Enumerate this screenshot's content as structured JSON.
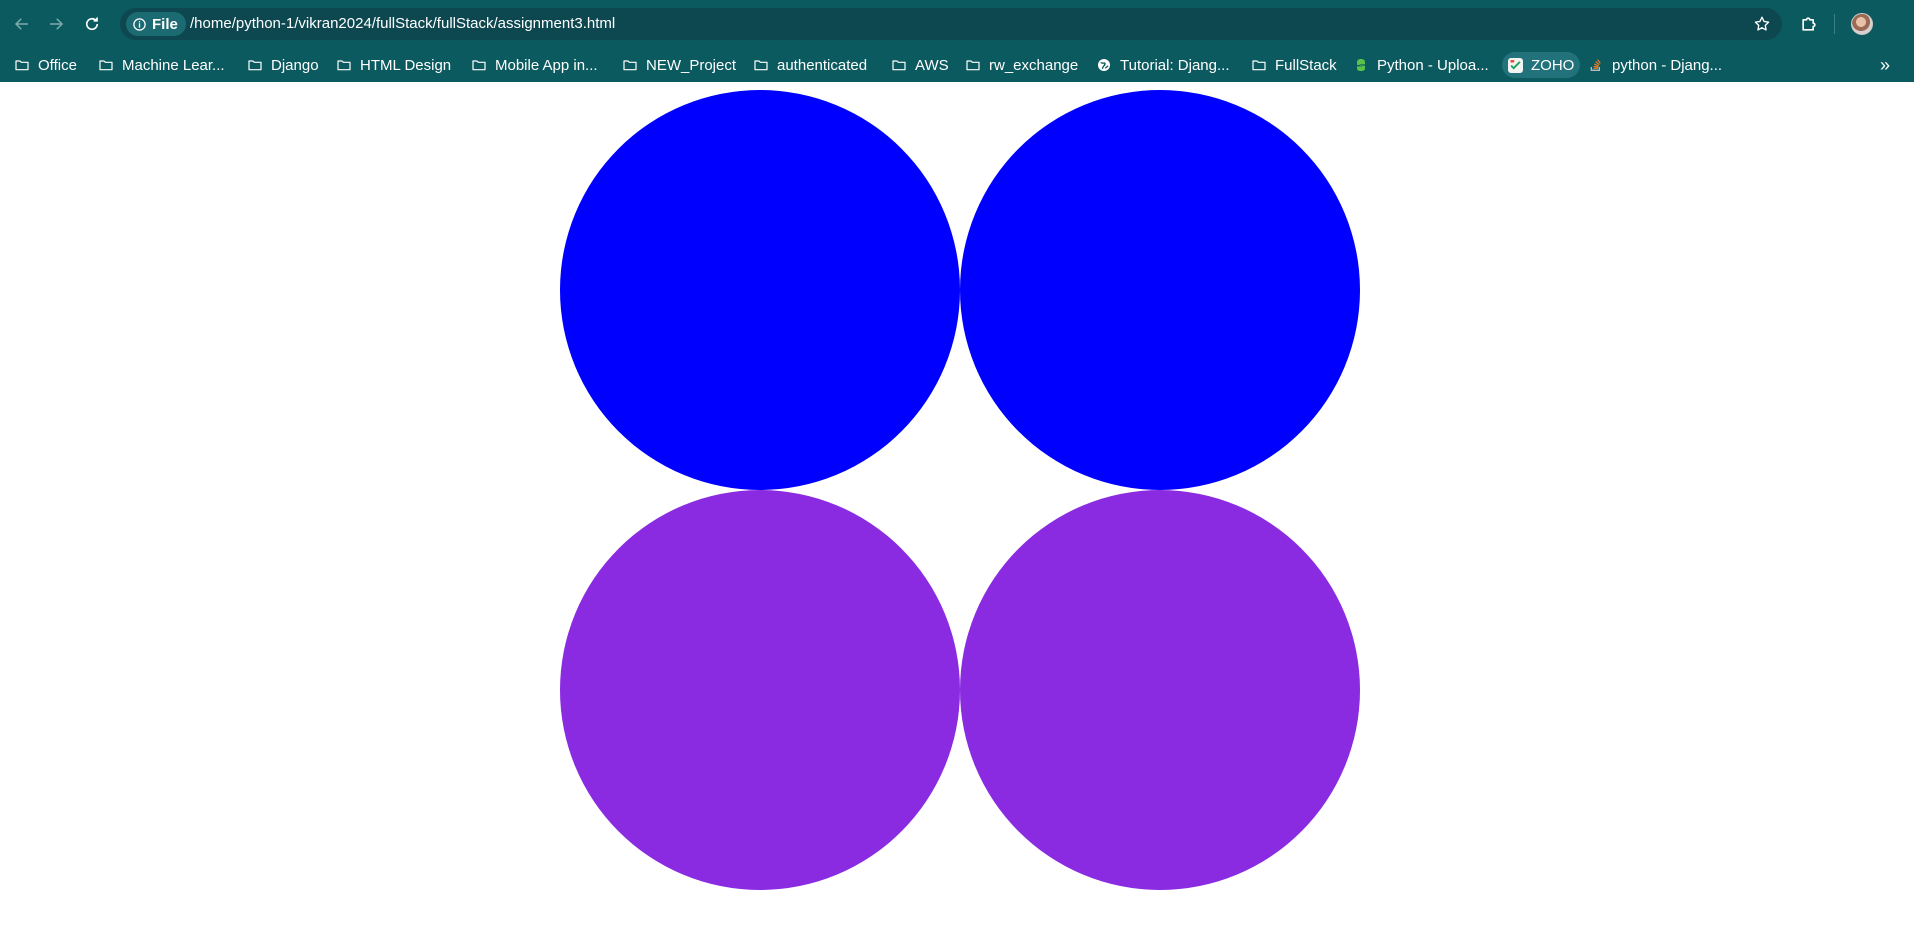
{
  "browser": {
    "site_chip_label": "File",
    "url": "/home/python-1/vikran2024/fullStack/fullStack/assignment3.html",
    "chrome_color": "#0b5a5f"
  },
  "bookmarks": [
    {
      "label": "Office",
      "icon": "folder-icon"
    },
    {
      "label": "Machine Lear...",
      "icon": "folder-icon"
    },
    {
      "label": "Django",
      "icon": "folder-icon"
    },
    {
      "label": "HTML Design",
      "icon": "folder-icon"
    },
    {
      "label": "Mobile App in...",
      "icon": "folder-icon"
    },
    {
      "label": "NEW_Project",
      "icon": "folder-icon"
    },
    {
      "label": "authenticated",
      "icon": "folder-icon"
    },
    {
      "label": "AWS",
      "icon": "folder-icon"
    },
    {
      "label": "rw_exchange",
      "icon": "folder-icon"
    },
    {
      "label": "Tutorial: Djang...",
      "icon": "globe-icon"
    },
    {
      "label": "FullStack",
      "icon": "folder-icon"
    },
    {
      "label": "Python - Uploa...",
      "icon": "python-logo-icon"
    },
    {
      "label": "ZOHO",
      "icon": "zoho-logo-icon"
    },
    {
      "label": "python - Djang...",
      "icon": "stackoverflow-icon"
    }
  ],
  "page": {
    "circles": [
      {
        "color": "#0000ff"
      },
      {
        "color": "#0000ff"
      },
      {
        "color": "#8a2be2"
      },
      {
        "color": "#8a2be2"
      }
    ]
  }
}
